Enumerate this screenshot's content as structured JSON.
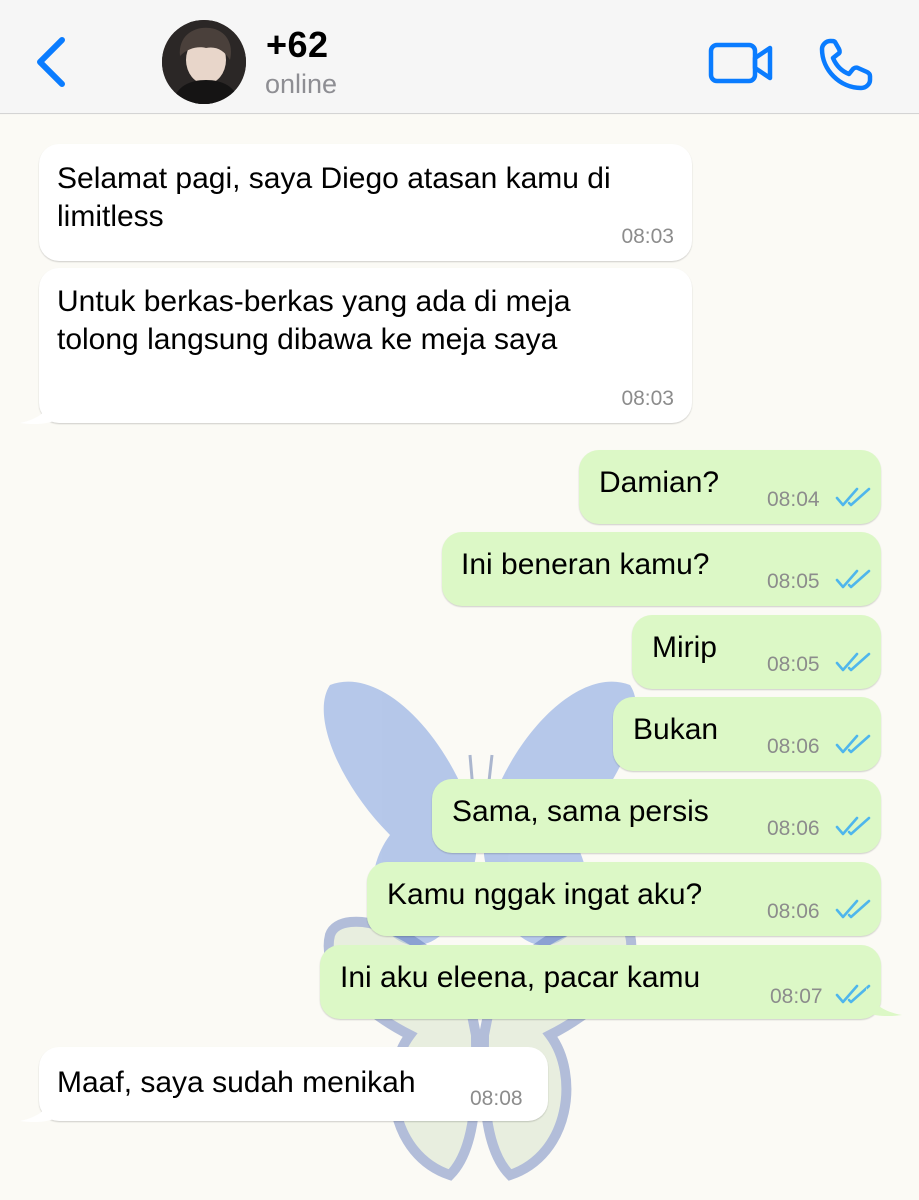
{
  "header": {
    "contact_name": "+62",
    "status": "online"
  },
  "messages": [
    {
      "direction": "in",
      "text": "Selamat pagi, saya Diego atasan kamu di limitless",
      "time": "08:03"
    },
    {
      "direction": "in",
      "text": "Untuk berkas-berkas yang ada di meja tolong langsung dibawa ke meja saya",
      "time": "08:03"
    },
    {
      "direction": "out",
      "text": "Damian?",
      "time": "08:04",
      "status": "read"
    },
    {
      "direction": "out",
      "text": "Ini beneran kamu?",
      "time": "08:05",
      "status": "read"
    },
    {
      "direction": "out",
      "text": "Mirip",
      "time": "08:05",
      "status": "read"
    },
    {
      "direction": "out",
      "text": "Bukan",
      "time": "08:06",
      "status": "read"
    },
    {
      "direction": "out",
      "text": "Sama, sama persis",
      "time": "08:06",
      "status": "read"
    },
    {
      "direction": "out",
      "text": "Kamu nggak ingat aku?",
      "time": "08:06",
      "status": "read"
    },
    {
      "direction": "out",
      "text": "Ini aku eleena, pacar kamu",
      "time": "08:07",
      "status": "read"
    },
    {
      "direction": "in",
      "text": "Maaf, saya sudah menikah",
      "time": "08:08"
    }
  ],
  "icons": {
    "back": "chevron-left-icon",
    "video": "video-camera-icon",
    "call": "phone-icon",
    "read_receipt": "double-check-icon"
  },
  "colors": {
    "accent": "#0a7cff",
    "incoming_bubble": "#ffffff",
    "outgoing_bubble": "#dcf8c6",
    "read_ticks": "#4fb6ec",
    "timestamp": "#8c8c8c"
  }
}
